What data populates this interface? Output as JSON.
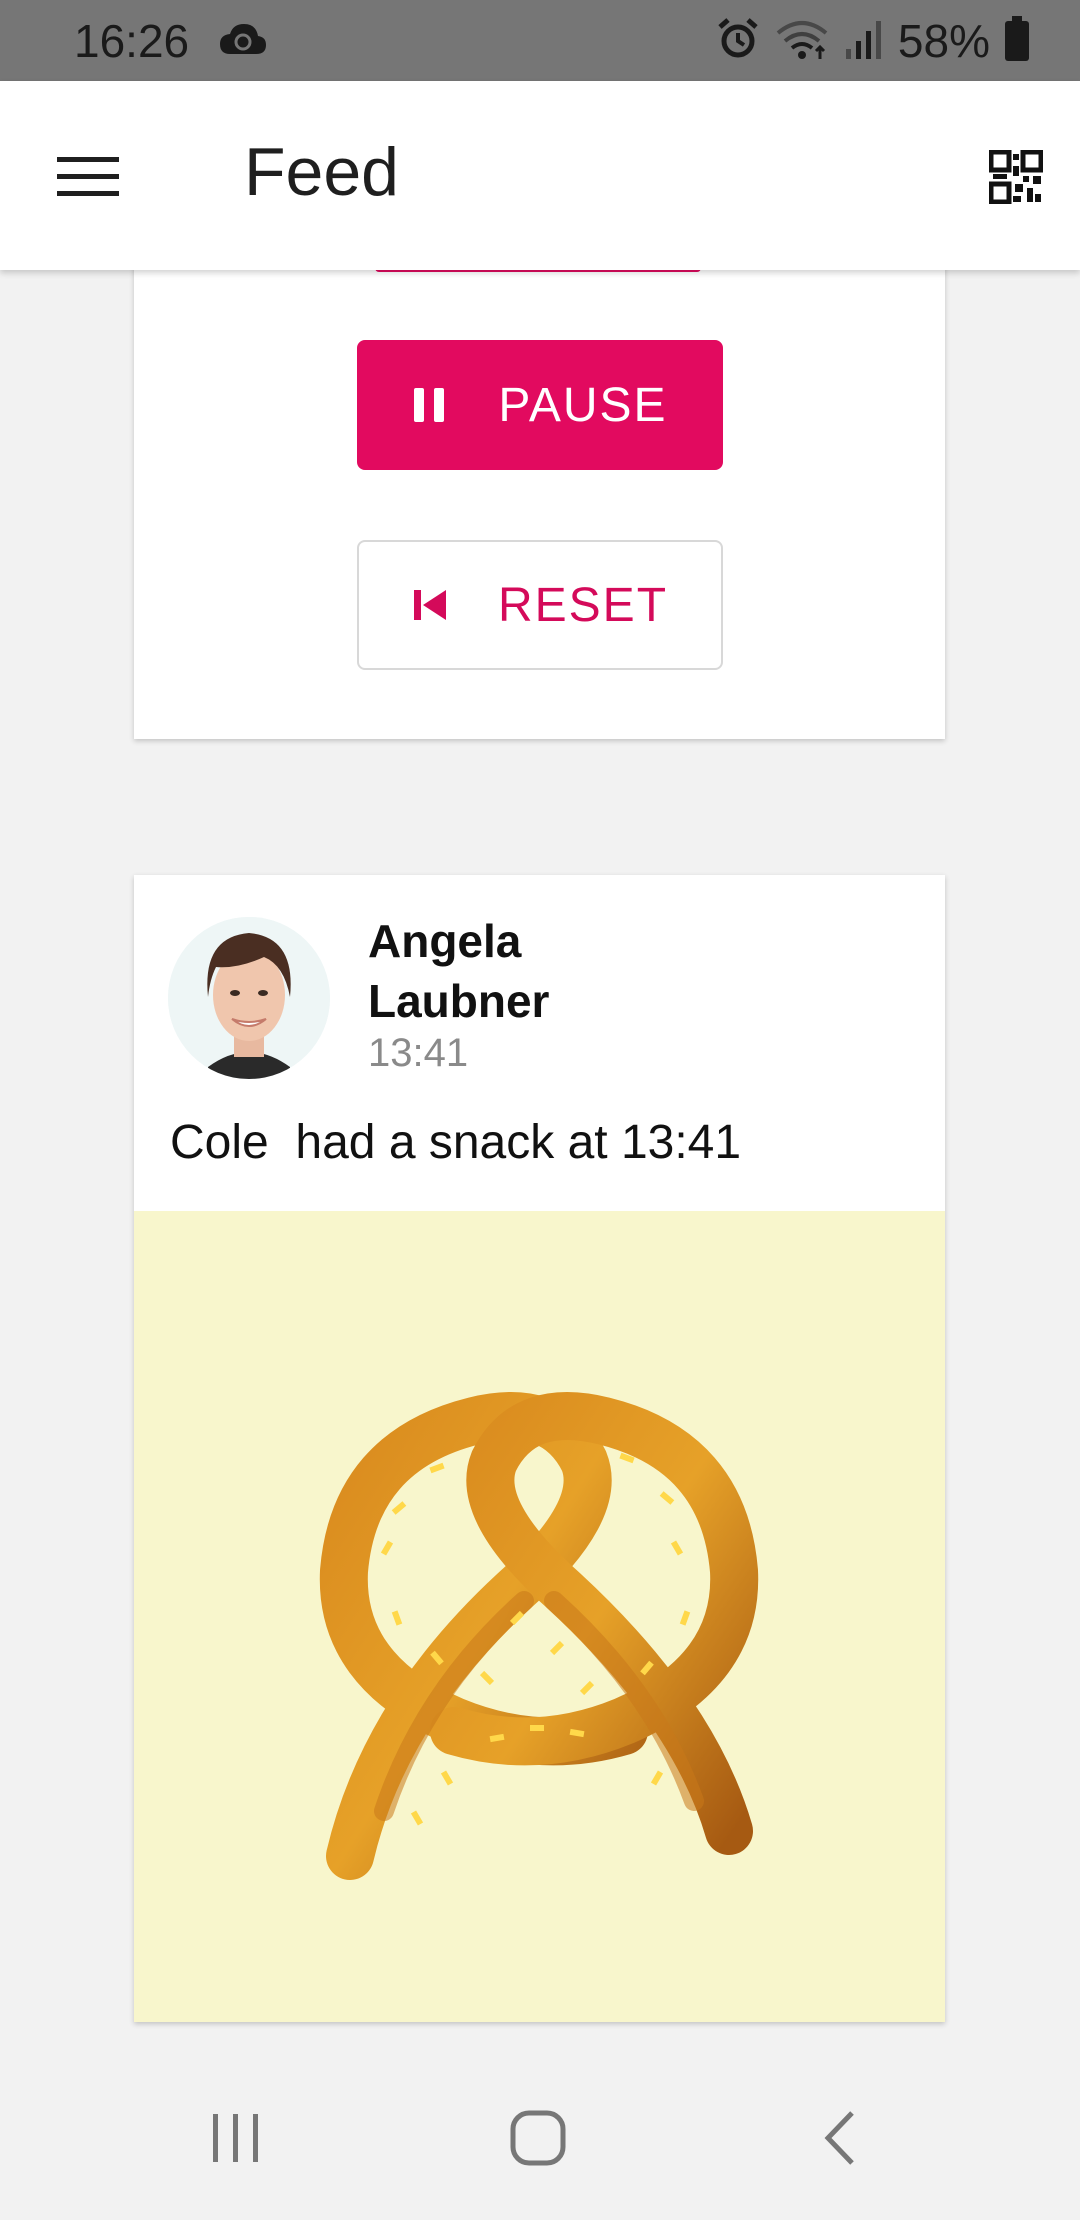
{
  "status_bar": {
    "time": "16:26",
    "battery_percent": "58%",
    "icons": [
      "cloud-sync-icon",
      "alarm-icon",
      "wifi-icon",
      "signal-icon",
      "battery-icon"
    ]
  },
  "app_bar": {
    "title": "Feed",
    "menu_icon": "hamburger-menu-icon",
    "qr_icon": "qr-code-icon"
  },
  "timer_card": {
    "pause_label": "PAUSE",
    "reset_label": "RESET",
    "accent_color": "#e20a5f"
  },
  "post": {
    "author": "Angela Laubner",
    "time": "13:41",
    "text": "Cole  had a snack at 13:41",
    "image": "pretzel-illustration",
    "image_bg": "#f8f6cc"
  },
  "nav_bar": {
    "icons": [
      "recent-apps-icon",
      "home-icon",
      "back-icon"
    ]
  }
}
